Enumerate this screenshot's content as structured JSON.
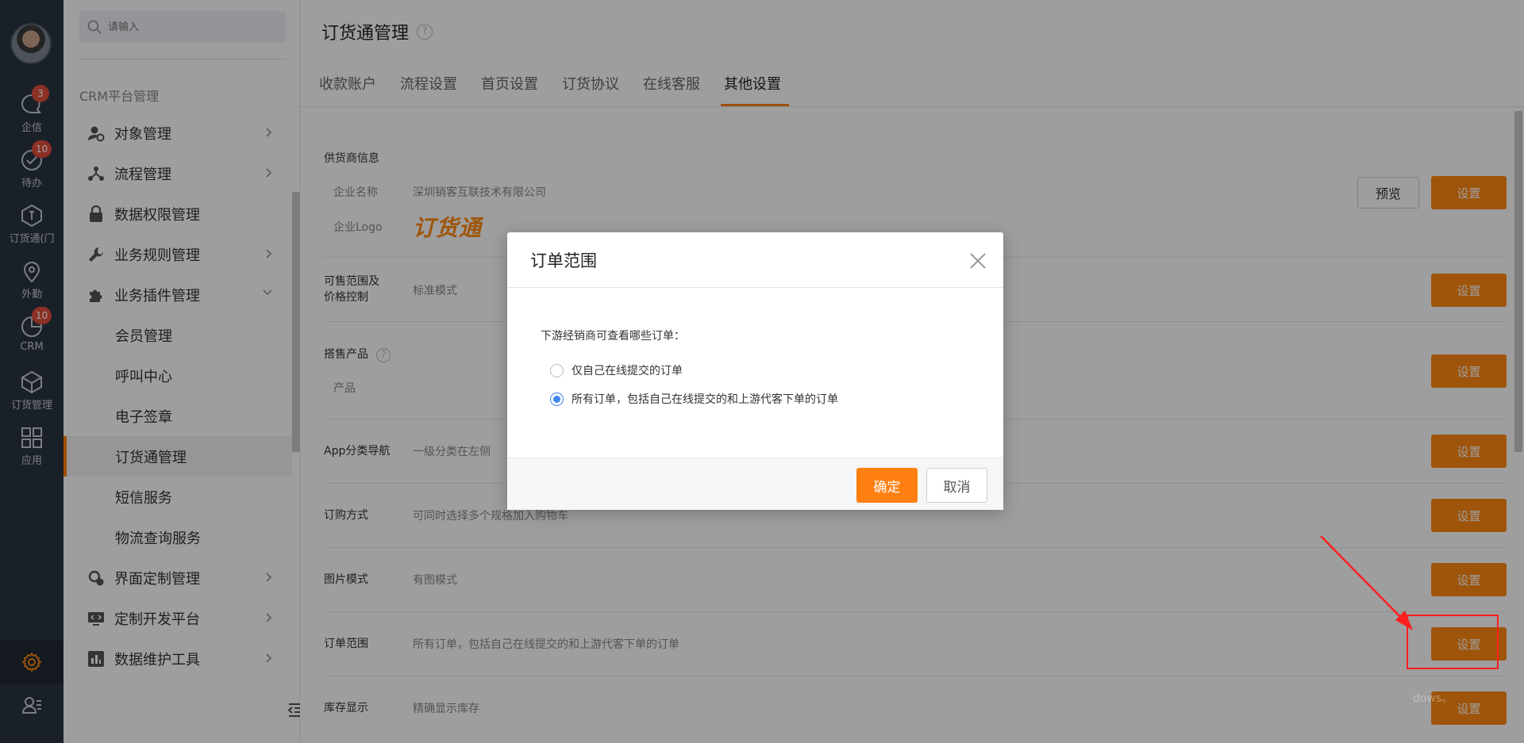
{
  "rail": {
    "items": [
      {
        "label": "企信",
        "icon": "chat-bubble-icon",
        "badge": "3"
      },
      {
        "label": "待办",
        "icon": "check-circle-icon",
        "badge": "10"
      },
      {
        "label": "订货通(门",
        "icon": "cube-order-icon",
        "badge": ""
      },
      {
        "label": "外勤",
        "icon": "location-pin-icon",
        "badge": ""
      },
      {
        "label": "CRM",
        "icon": "pie-chart-icon",
        "badge": "10"
      },
      {
        "label": "订货管理",
        "icon": "box-icon",
        "badge": ""
      },
      {
        "label": "应用",
        "icon": "grid-apps-icon",
        "badge": ""
      }
    ]
  },
  "sidebar": {
    "search_placeholder": "请输入",
    "section_title": "CRM平台管理",
    "items": [
      {
        "label": "对象管理",
        "icon": "user-gear-icon",
        "has_arrow": true
      },
      {
        "label": "流程管理",
        "icon": "flow-icon",
        "has_arrow": true
      },
      {
        "label": "数据权限管理",
        "icon": "lock-icon",
        "has_arrow": false
      },
      {
        "label": "业务规则管理",
        "icon": "wrench-icon",
        "has_arrow": true
      },
      {
        "label": "业务插件管理",
        "icon": "puzzle-icon",
        "has_arrow": true,
        "expanded": true
      },
      {
        "label": "会员管理",
        "sub": true
      },
      {
        "label": "呼叫中心",
        "sub": true
      },
      {
        "label": "电子签章",
        "sub": true
      },
      {
        "label": "订货通管理",
        "sub": true,
        "active": true
      },
      {
        "label": "短信服务",
        "sub": true
      },
      {
        "label": "物流查询服务",
        "sub": true
      },
      {
        "label": "界面定制管理",
        "icon": "ui-gear-icon",
        "has_arrow": true
      },
      {
        "label": "定制开发平台",
        "icon": "code-monitor-icon",
        "has_arrow": true
      },
      {
        "label": "数据维护工具",
        "icon": "bar-chart-icon",
        "has_arrow": true
      }
    ]
  },
  "main": {
    "title": "订货通管理",
    "help": "?",
    "tabs": [
      "收款账户",
      "流程设置",
      "首页设置",
      "订货协议",
      "在线客服",
      "其他设置"
    ],
    "active_tab": "其他设置",
    "supplier": {
      "label": "供货商信息",
      "company_label": "企业名称",
      "company_value": "深圳销客互联技术有限公司",
      "logo_label": "企业Logo",
      "logo_text": "订货通",
      "preview": "预览"
    },
    "rows": [
      {
        "label": "可售范围及\n价格控制",
        "value": "标准模式"
      },
      {
        "label": "搭售产品",
        "sublabel": "产品",
        "value": ""
      },
      {
        "label": "App分类导航",
        "value": "一级分类在左侧"
      },
      {
        "label": "订购方式",
        "value": "可同时选择多个规格加入购物车"
      },
      {
        "label": "图片模式",
        "value": "有图模式"
      },
      {
        "label": "订单范围",
        "value": "所有订单，包括自己在线提交的和上游代客下单的订单"
      },
      {
        "label": "库存显示",
        "value": "精确显示库存"
      }
    ],
    "set_label": "设置"
  },
  "modal": {
    "title": "订单范围",
    "question": "下游经销商可查看哪些订单：",
    "options": [
      {
        "label": "仅自己在线提交的订单",
        "checked": false
      },
      {
        "label": "所有订单，包括自己在线提交的和上游代客下单的订单",
        "checked": true
      }
    ],
    "ok": "确定",
    "cancel": "取消"
  },
  "watermark": "dows。",
  "colors": {
    "accent": "#ff8a12",
    "rail_bg": "#2b3440",
    "highlight": "#ff1f1f",
    "radio": "#3e86f0"
  }
}
